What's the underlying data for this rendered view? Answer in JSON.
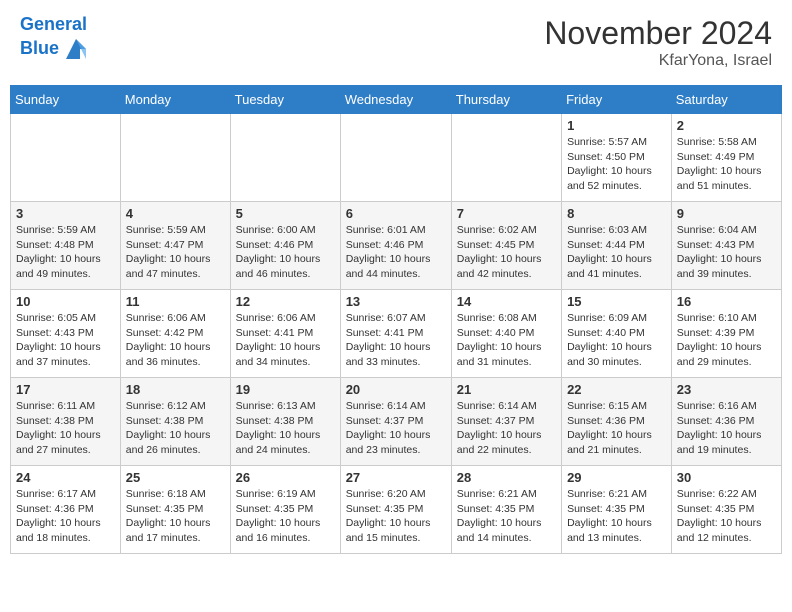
{
  "header": {
    "logo_line1": "General",
    "logo_line2": "Blue",
    "month_title": "November 2024",
    "location": "KfarYona, Israel"
  },
  "days_of_week": [
    "Sunday",
    "Monday",
    "Tuesday",
    "Wednesday",
    "Thursday",
    "Friday",
    "Saturday"
  ],
  "weeks": [
    [
      {
        "day": "",
        "info": ""
      },
      {
        "day": "",
        "info": ""
      },
      {
        "day": "",
        "info": ""
      },
      {
        "day": "",
        "info": ""
      },
      {
        "day": "",
        "info": ""
      },
      {
        "day": "1",
        "info": "Sunrise: 5:57 AM\nSunset: 4:50 PM\nDaylight: 10 hours and 52 minutes."
      },
      {
        "day": "2",
        "info": "Sunrise: 5:58 AM\nSunset: 4:49 PM\nDaylight: 10 hours and 51 minutes."
      }
    ],
    [
      {
        "day": "3",
        "info": "Sunrise: 5:59 AM\nSunset: 4:48 PM\nDaylight: 10 hours and 49 minutes."
      },
      {
        "day": "4",
        "info": "Sunrise: 5:59 AM\nSunset: 4:47 PM\nDaylight: 10 hours and 47 minutes."
      },
      {
        "day": "5",
        "info": "Sunrise: 6:00 AM\nSunset: 4:46 PM\nDaylight: 10 hours and 46 minutes."
      },
      {
        "day": "6",
        "info": "Sunrise: 6:01 AM\nSunset: 4:46 PM\nDaylight: 10 hours and 44 minutes."
      },
      {
        "day": "7",
        "info": "Sunrise: 6:02 AM\nSunset: 4:45 PM\nDaylight: 10 hours and 42 minutes."
      },
      {
        "day": "8",
        "info": "Sunrise: 6:03 AM\nSunset: 4:44 PM\nDaylight: 10 hours and 41 minutes."
      },
      {
        "day": "9",
        "info": "Sunrise: 6:04 AM\nSunset: 4:43 PM\nDaylight: 10 hours and 39 minutes."
      }
    ],
    [
      {
        "day": "10",
        "info": "Sunrise: 6:05 AM\nSunset: 4:43 PM\nDaylight: 10 hours and 37 minutes."
      },
      {
        "day": "11",
        "info": "Sunrise: 6:06 AM\nSunset: 4:42 PM\nDaylight: 10 hours and 36 minutes."
      },
      {
        "day": "12",
        "info": "Sunrise: 6:06 AM\nSunset: 4:41 PM\nDaylight: 10 hours and 34 minutes."
      },
      {
        "day": "13",
        "info": "Sunrise: 6:07 AM\nSunset: 4:41 PM\nDaylight: 10 hours and 33 minutes."
      },
      {
        "day": "14",
        "info": "Sunrise: 6:08 AM\nSunset: 4:40 PM\nDaylight: 10 hours and 31 minutes."
      },
      {
        "day": "15",
        "info": "Sunrise: 6:09 AM\nSunset: 4:40 PM\nDaylight: 10 hours and 30 minutes."
      },
      {
        "day": "16",
        "info": "Sunrise: 6:10 AM\nSunset: 4:39 PM\nDaylight: 10 hours and 29 minutes."
      }
    ],
    [
      {
        "day": "17",
        "info": "Sunrise: 6:11 AM\nSunset: 4:38 PM\nDaylight: 10 hours and 27 minutes."
      },
      {
        "day": "18",
        "info": "Sunrise: 6:12 AM\nSunset: 4:38 PM\nDaylight: 10 hours and 26 minutes."
      },
      {
        "day": "19",
        "info": "Sunrise: 6:13 AM\nSunset: 4:38 PM\nDaylight: 10 hours and 24 minutes."
      },
      {
        "day": "20",
        "info": "Sunrise: 6:14 AM\nSunset: 4:37 PM\nDaylight: 10 hours and 23 minutes."
      },
      {
        "day": "21",
        "info": "Sunrise: 6:14 AM\nSunset: 4:37 PM\nDaylight: 10 hours and 22 minutes."
      },
      {
        "day": "22",
        "info": "Sunrise: 6:15 AM\nSunset: 4:36 PM\nDaylight: 10 hours and 21 minutes."
      },
      {
        "day": "23",
        "info": "Sunrise: 6:16 AM\nSunset: 4:36 PM\nDaylight: 10 hours and 19 minutes."
      }
    ],
    [
      {
        "day": "24",
        "info": "Sunrise: 6:17 AM\nSunset: 4:36 PM\nDaylight: 10 hours and 18 minutes."
      },
      {
        "day": "25",
        "info": "Sunrise: 6:18 AM\nSunset: 4:35 PM\nDaylight: 10 hours and 17 minutes."
      },
      {
        "day": "26",
        "info": "Sunrise: 6:19 AM\nSunset: 4:35 PM\nDaylight: 10 hours and 16 minutes."
      },
      {
        "day": "27",
        "info": "Sunrise: 6:20 AM\nSunset: 4:35 PM\nDaylight: 10 hours and 15 minutes."
      },
      {
        "day": "28",
        "info": "Sunrise: 6:21 AM\nSunset: 4:35 PM\nDaylight: 10 hours and 14 minutes."
      },
      {
        "day": "29",
        "info": "Sunrise: 6:21 AM\nSunset: 4:35 PM\nDaylight: 10 hours and 13 minutes."
      },
      {
        "day": "30",
        "info": "Sunrise: 6:22 AM\nSunset: 4:35 PM\nDaylight: 10 hours and 12 minutes."
      }
    ]
  ]
}
